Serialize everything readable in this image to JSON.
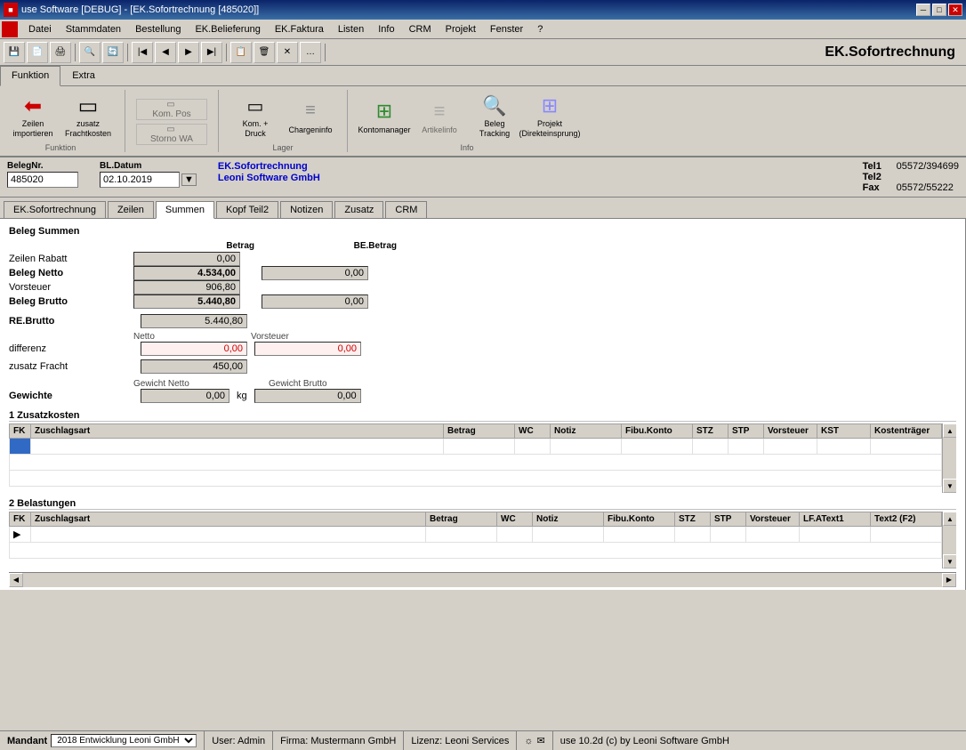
{
  "titleBar": {
    "title": "use Software [DEBUG] - [EK.Sofortrechnung [485020]]",
    "icon": "app-icon",
    "controls": [
      "minimize",
      "maximize",
      "close"
    ]
  },
  "menuBar": {
    "items": [
      "Datei",
      "Stammdaten",
      "Bestellung",
      "EK.Belieferung",
      "EK.Faktura",
      "Listen",
      "Info",
      "CRM",
      "Projekt",
      "Fenster",
      "?"
    ]
  },
  "toolbar": {
    "buttons": [
      "save",
      "new",
      "print",
      "search",
      "refresh",
      "first",
      "prev",
      "next",
      "last",
      "copy",
      "delete",
      "cancel",
      "more"
    ]
  },
  "ekTitle": "EK.Sofortrechnung",
  "ribbon": {
    "tabs": [
      {
        "label": "Funktion",
        "active": true
      },
      {
        "label": "Extra",
        "active": false
      }
    ],
    "groups": [
      {
        "label": "Funktion",
        "buttons": [
          {
            "label": "Zeilen importieren",
            "icon": "⬅",
            "disabled": false
          },
          {
            "label": "zusatz Frachtkosten",
            "icon": "▭",
            "disabled": false
          }
        ]
      },
      {
        "label": "",
        "smallButtons": [
          {
            "label": "Kom. Pos",
            "disabled": true
          },
          {
            "label": "Storno WA",
            "disabled": true
          }
        ]
      },
      {
        "label": "Lager",
        "buttons": [
          {
            "label": "Kom. + Druck",
            "icon": "▭",
            "disabled": false
          },
          {
            "label": "Chargeninfo",
            "icon": "",
            "disabled": false
          }
        ]
      },
      {
        "label": "Info",
        "buttons": [
          {
            "label": "Kontomanager",
            "icon": "⊞",
            "disabled": false
          },
          {
            "label": "Artikelinfo",
            "icon": "≡",
            "disabled": true
          },
          {
            "label": "Beleg Tracking",
            "icon": "🔍",
            "disabled": false
          },
          {
            "label": "Projekt (Direkteinsprung)",
            "icon": "⊞",
            "disabled": false
          }
        ]
      }
    ]
  },
  "formHeader": {
    "belegNrLabel": "BelegNr.",
    "belegNrValue": "485020",
    "blDatumLabel": "BL.Datum",
    "blDatumValue": "02.10.2019",
    "ekSofortLabel": "EK.Sofortrechnung",
    "companyName": "Leoni Software  GmbH",
    "tel1Label": "Tel1",
    "tel1Value": "05572/394699",
    "tel2Label": "Tel2",
    "tel2Value": "",
    "faxLabel": "Fax",
    "faxValue": "05572/55222"
  },
  "tabs": [
    {
      "label": "EK.Sofortrechnung",
      "active": false
    },
    {
      "label": "Zeilen",
      "active": false
    },
    {
      "label": "Summen",
      "active": true
    },
    {
      "label": "Kopf Teil2",
      "active": false
    },
    {
      "label": "Notizen",
      "active": false
    },
    {
      "label": "Zusatz",
      "active": false
    },
    {
      "label": "CRM",
      "active": false
    }
  ],
  "summen": {
    "title": "Beleg Summen",
    "betragHeader": "Betrag",
    "beBetragHeader": "BE.Betrag",
    "rows": [
      {
        "label": "Zeilen Rabatt",
        "betrag": "0,00",
        "beBetrag": null
      },
      {
        "label": "Beleg Netto",
        "betrag": "4.534,00",
        "beBetrag": "0,00",
        "bold": true
      },
      {
        "label": "Vorsteuer",
        "betrag": "906,80",
        "beBetrag": null
      },
      {
        "label": "Beleg Brutto",
        "betrag": "5.440,80",
        "beBetrag": "0,00",
        "bold": true
      }
    ],
    "reBruttoLabel": "RE.Brutto",
    "reBruttoValue": "5.440,80",
    "differenzLabel": "differenz",
    "nettoSubLabel": "Netto",
    "vorsteuerSubLabel": "Vorsteuer",
    "differenzNetto": "0,00",
    "differenzVorsteuer": "0,00",
    "zusatzFrachtLabel": "zusatz Fracht",
    "zusatzFrachtValue": "450,00",
    "gewichteLabel": "Gewichte",
    "gewichtNettoSubLabel": "Gewicht Netto",
    "gewichtBruttoSubLabel": "Gewicht Brutto",
    "gewichtNettoValue": "0,00",
    "gewichtNettoUnit": "kg",
    "gewichtBruttoValue": "0,00"
  },
  "zusatzkosten": {
    "title": "1 Zusatzkosten",
    "columns": [
      "FK",
      "Zuschlagsart",
      "Betrag",
      "WC",
      "Notiz",
      "Fibu.Konto",
      "STZ",
      "STP",
      "Vorsteuer",
      "KST",
      "Kostenträger"
    ],
    "rows": []
  },
  "belastungen": {
    "title": "2 Belastungen",
    "columns": [
      "FK",
      "Zuschlagsart",
      "Betrag",
      "WC",
      "Notiz",
      "Fibu.Konto",
      "STZ",
      "STP",
      "Vorsteuer",
      "LF.AText1",
      "Text2 (F2)"
    ],
    "rows": []
  },
  "statusBar": {
    "mandantLabel": "Mandant",
    "mandantValue": "2018  Entwicklung Leoni GmbH",
    "userLabel": "User: Admin",
    "firmaLabel": "Firma: Mustermann GmbH",
    "lizenzLabel": "Lizenz: Leoni Services",
    "versionLabel": "use 10.2d  (c) by Leoni Software GmbH"
  },
  "colors": {
    "accent": "#0a246a",
    "background": "#d4d0c8",
    "white": "#ffffff",
    "red": "#cc0000",
    "blue": "#0000cc",
    "selectedBlue": "#316ac5"
  }
}
